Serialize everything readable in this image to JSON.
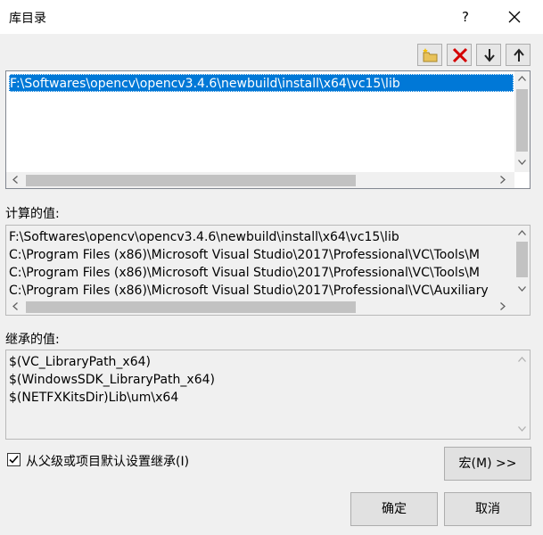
{
  "window": {
    "title": "库目录",
    "help_label": "?"
  },
  "toolbar": {
    "buttons": [
      {
        "name": "new-line-button",
        "icon": "new-folder-icon"
      },
      {
        "name": "delete-line-button",
        "icon": "delete-x-icon"
      },
      {
        "name": "move-down-button",
        "icon": "arrow-down-icon"
      },
      {
        "name": "move-up-button",
        "icon": "arrow-up-icon"
      }
    ]
  },
  "edit_list": {
    "items": [
      "F:\\Softwares\\opencv\\opencv3.4.6\\newbuild\\install\\x64\\vc15\\lib"
    ]
  },
  "evaluated": {
    "label": "计算的值:",
    "items": [
      "F:\\Softwares\\opencv\\opencv3.4.6\\newbuild\\install\\x64\\vc15\\lib",
      "C:\\Program Files (x86)\\Microsoft Visual Studio\\2017\\Professional\\VC\\Tools\\M",
      "C:\\Program Files (x86)\\Microsoft Visual Studio\\2017\\Professional\\VC\\Tools\\M",
      "C:\\Program Files (x86)\\Microsoft Visual Studio\\2017\\Professional\\VC\\Auxiliary"
    ]
  },
  "inherited": {
    "label": "继承的值:",
    "items": [
      "$(VC_LibraryPath_x64)",
      "$(WindowsSDK_LibraryPath_x64)",
      "$(NETFXKitsDir)Lib\\um\\x64"
    ]
  },
  "inherit_checkbox": {
    "label": "从父级或项目默认设置继承(I)",
    "checked": true
  },
  "buttons": {
    "macros": "宏(M) >>",
    "ok": "确定",
    "cancel": "取消"
  },
  "colors": {
    "selection": "#0078d7",
    "dialog_bg": "#f0f0f0",
    "delete_icon": "#d40000"
  }
}
